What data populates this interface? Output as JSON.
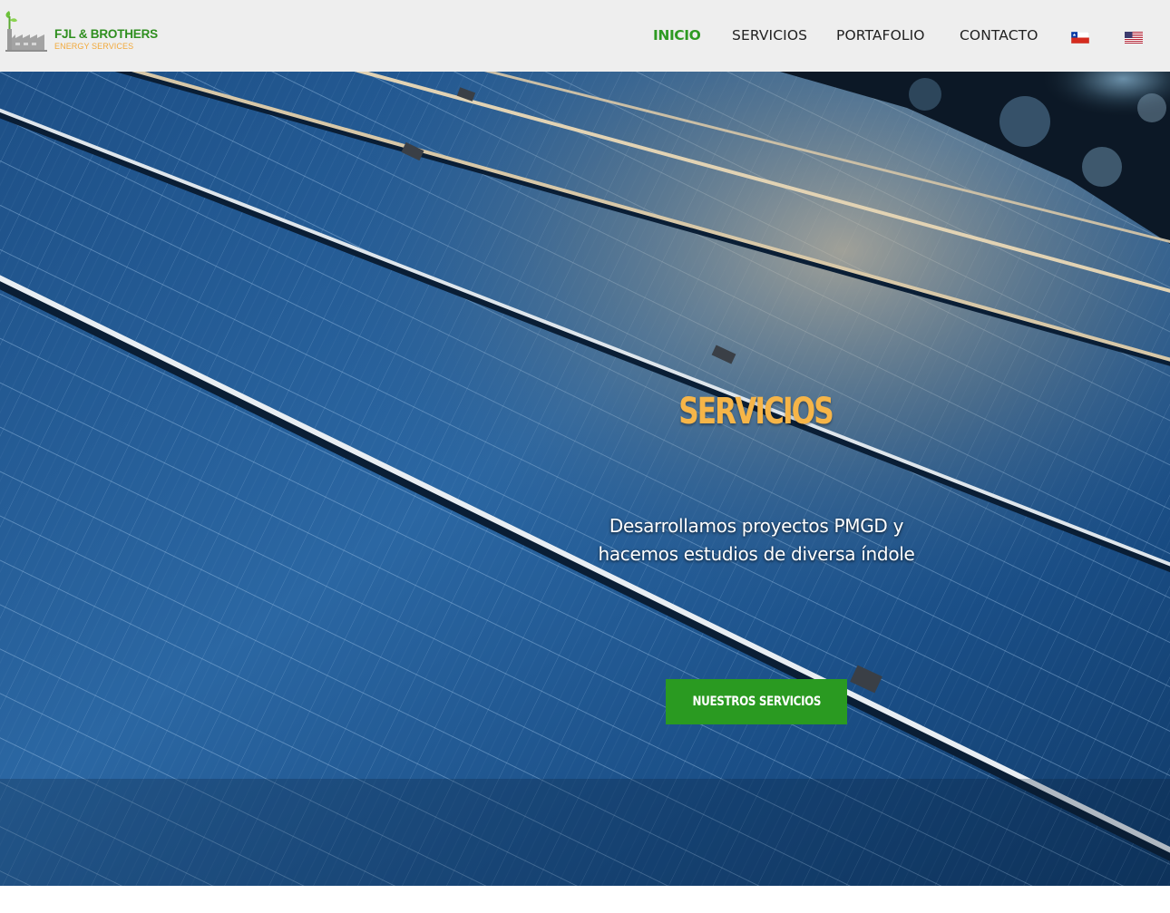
{
  "brand": {
    "name": "FJL & BROTHERS",
    "tagline": "ENERGY SERVICES",
    "logo_icon": "factory-plant-icon"
  },
  "nav": {
    "items": [
      {
        "label": "INICIO",
        "active": true
      },
      {
        "label": "SERVICIOS",
        "active": false
      },
      {
        "label": "PORTAFOLIO",
        "active": false
      },
      {
        "label": "CONTACTO",
        "active": false
      }
    ],
    "languages": [
      {
        "icon": "chile-flag-icon"
      },
      {
        "icon": "usa-flag-icon"
      }
    ]
  },
  "hero": {
    "title": "SERVICIOS",
    "subtitle_line1": "Desarrollamos proyectos PMGD y",
    "subtitle_line2": "hacemos estudios de diversa índole",
    "button_label": "NUESTROS SERVICIOS",
    "background": "solar-panels-photo"
  },
  "colors": {
    "header_bg": "#eeeeee",
    "nav_active": "#2e9a22",
    "brand_green": "#2f8f1f",
    "brand_orange": "#f2a93b",
    "title_orange": "#f6b548",
    "button_green": "#2a9a21"
  }
}
